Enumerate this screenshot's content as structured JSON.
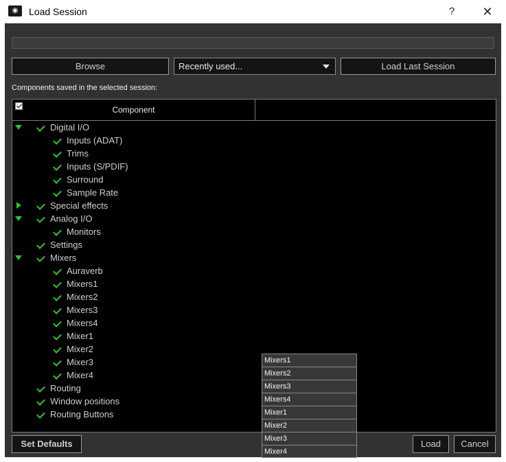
{
  "window": {
    "title": "Load Session",
    "help_glyph": "?",
    "close_glyph": "✕",
    "icon": "app-icon"
  },
  "toolbar": {
    "browse_label": "Browse",
    "recent_value": "Recently used...",
    "load_last_label": "Load Last Session"
  },
  "components_label": "Components saved in the selected session:",
  "table": {
    "column_header": "Component"
  },
  "tree": [
    {
      "label": "Digital I/O",
      "level": 0,
      "expander": "expanded"
    },
    {
      "label": "Inputs (ADAT)",
      "level": 1,
      "expander": "none"
    },
    {
      "label": "Trims",
      "level": 1,
      "expander": "none"
    },
    {
      "label": "Inputs (S/PDIF)",
      "level": 1,
      "expander": "none"
    },
    {
      "label": "Surround",
      "level": 1,
      "expander": "none"
    },
    {
      "label": "Sample Rate",
      "level": 1,
      "expander": "none"
    },
    {
      "label": "Special effects",
      "level": 0,
      "expander": "collapsed"
    },
    {
      "label": "Analog I/O",
      "level": 0,
      "expander": "expanded"
    },
    {
      "label": "Monitors",
      "level": 1,
      "expander": "none"
    },
    {
      "label": "Settings",
      "level": 0,
      "expander": "none"
    },
    {
      "label": "Mixers",
      "level": 0,
      "expander": "expanded"
    },
    {
      "label": "Auraverb",
      "level": 1,
      "expander": "none"
    },
    {
      "label": "Mixers1",
      "level": 1,
      "expander": "none"
    },
    {
      "label": "Mixers2",
      "level": 1,
      "expander": "none"
    },
    {
      "label": "Mixers3",
      "level": 1,
      "expander": "none"
    },
    {
      "label": "Mixers4",
      "level": 1,
      "expander": "none"
    },
    {
      "label": "Mixer1",
      "level": 1,
      "expander": "none"
    },
    {
      "label": "Mixer2",
      "level": 1,
      "expander": "none"
    },
    {
      "label": "Mixer3",
      "level": 1,
      "expander": "none"
    },
    {
      "label": "Mixer4",
      "level": 1,
      "expander": "none"
    },
    {
      "label": "Routing",
      "level": 0,
      "expander": "none"
    },
    {
      "label": "Window positions",
      "level": 0,
      "expander": "none"
    },
    {
      "label": "Routing Buttons",
      "level": 0,
      "expander": "none"
    }
  ],
  "popup_list": [
    "Mixers1",
    "Mixers2",
    "Mixers3",
    "Mixers4",
    "Mixer1",
    "Mixer2",
    "Mixer3",
    "Mixer4"
  ],
  "footer": {
    "set_defaults_label": "Set Defaults",
    "load_label": "Load",
    "cancel_label": "Cancel"
  },
  "colors": {
    "check_green": "#2ec42e",
    "dialog_bg": "#323232",
    "tree_bg": "#000000"
  }
}
